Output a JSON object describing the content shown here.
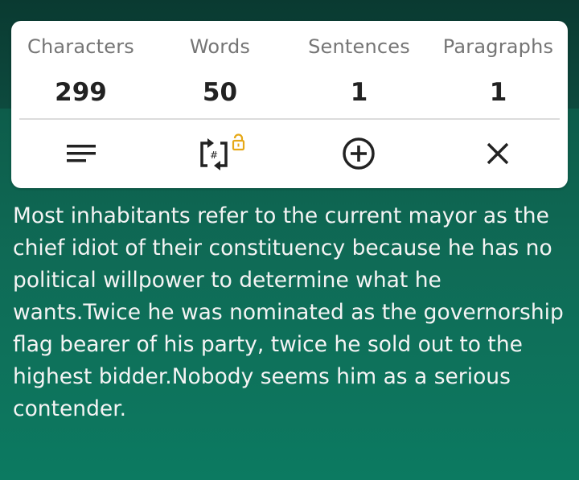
{
  "stats": [
    {
      "label": "Characters",
      "value": "299"
    },
    {
      "label": "Words",
      "value": "50"
    },
    {
      "label": "Sentences",
      "value": "1"
    },
    {
      "label": "Paragraphs",
      "value": "1"
    }
  ],
  "toolbar": {
    "icons": [
      "menu-icon",
      "hash-sync-icon",
      "lock-icon",
      "add-circle-icon",
      "close-icon"
    ],
    "lock_color": "#e6a817"
  },
  "content": {
    "text": "Most inhabitants refer to the current mayor as the chief idiot of their constituency because he has no political willpower to determine what he wants.Twice he was nominated as the governorship flag bearer of his party, twice he sold out to the highest bidder.Nobody seems him as a serious contender."
  }
}
